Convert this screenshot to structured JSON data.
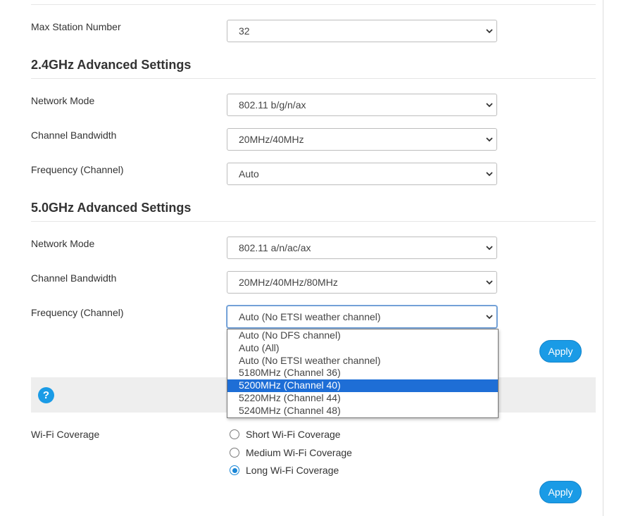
{
  "max_station": {
    "label": "Max Station Number",
    "value": "32"
  },
  "section_24": {
    "title": "2.4GHz Advanced Settings",
    "network_mode": {
      "label": "Network Mode",
      "value": "802.11 b/g/n/ax"
    },
    "channel_bandwidth": {
      "label": "Channel Bandwidth",
      "value": "20MHz/40MHz"
    },
    "frequency": {
      "label": "Frequency (Channel)",
      "value": "Auto"
    }
  },
  "section_50": {
    "title": "5.0GHz Advanced Settings",
    "network_mode": {
      "label": "Network Mode",
      "value": "802.11 a/n/ac/ax"
    },
    "channel_bandwidth": {
      "label": "Channel Bandwidth",
      "value": "20MHz/40MHz/80MHz"
    },
    "frequency": {
      "label": "Frequency (Channel)",
      "value": "Auto (No ETSI weather channel)",
      "options": [
        "Auto (No DFS channel)",
        "Auto (All)",
        "Auto (No ETSI weather channel)",
        "5180MHz (Channel 36)",
        "5200MHz (Channel 40)",
        "5220MHz (Channel 44)",
        "5240MHz (Channel 48)"
      ],
      "highlighted_option": "5200MHz (Channel 40)"
    },
    "apply_label": "Apply"
  },
  "help": {
    "icon": "question-icon",
    "symbol": "?"
  },
  "coverage": {
    "label": "Wi-Fi Coverage",
    "options": [
      {
        "label": "Short Wi-Fi Coverage",
        "checked": false
      },
      {
        "label": "Medium Wi-Fi Coverage",
        "checked": false
      },
      {
        "label": "Long Wi-Fi Coverage",
        "checked": true
      }
    ],
    "apply_label": "Apply"
  },
  "colors": {
    "accent": "#1a9be6",
    "highlight": "#1e6ed6",
    "panel": "#eeeeee"
  }
}
